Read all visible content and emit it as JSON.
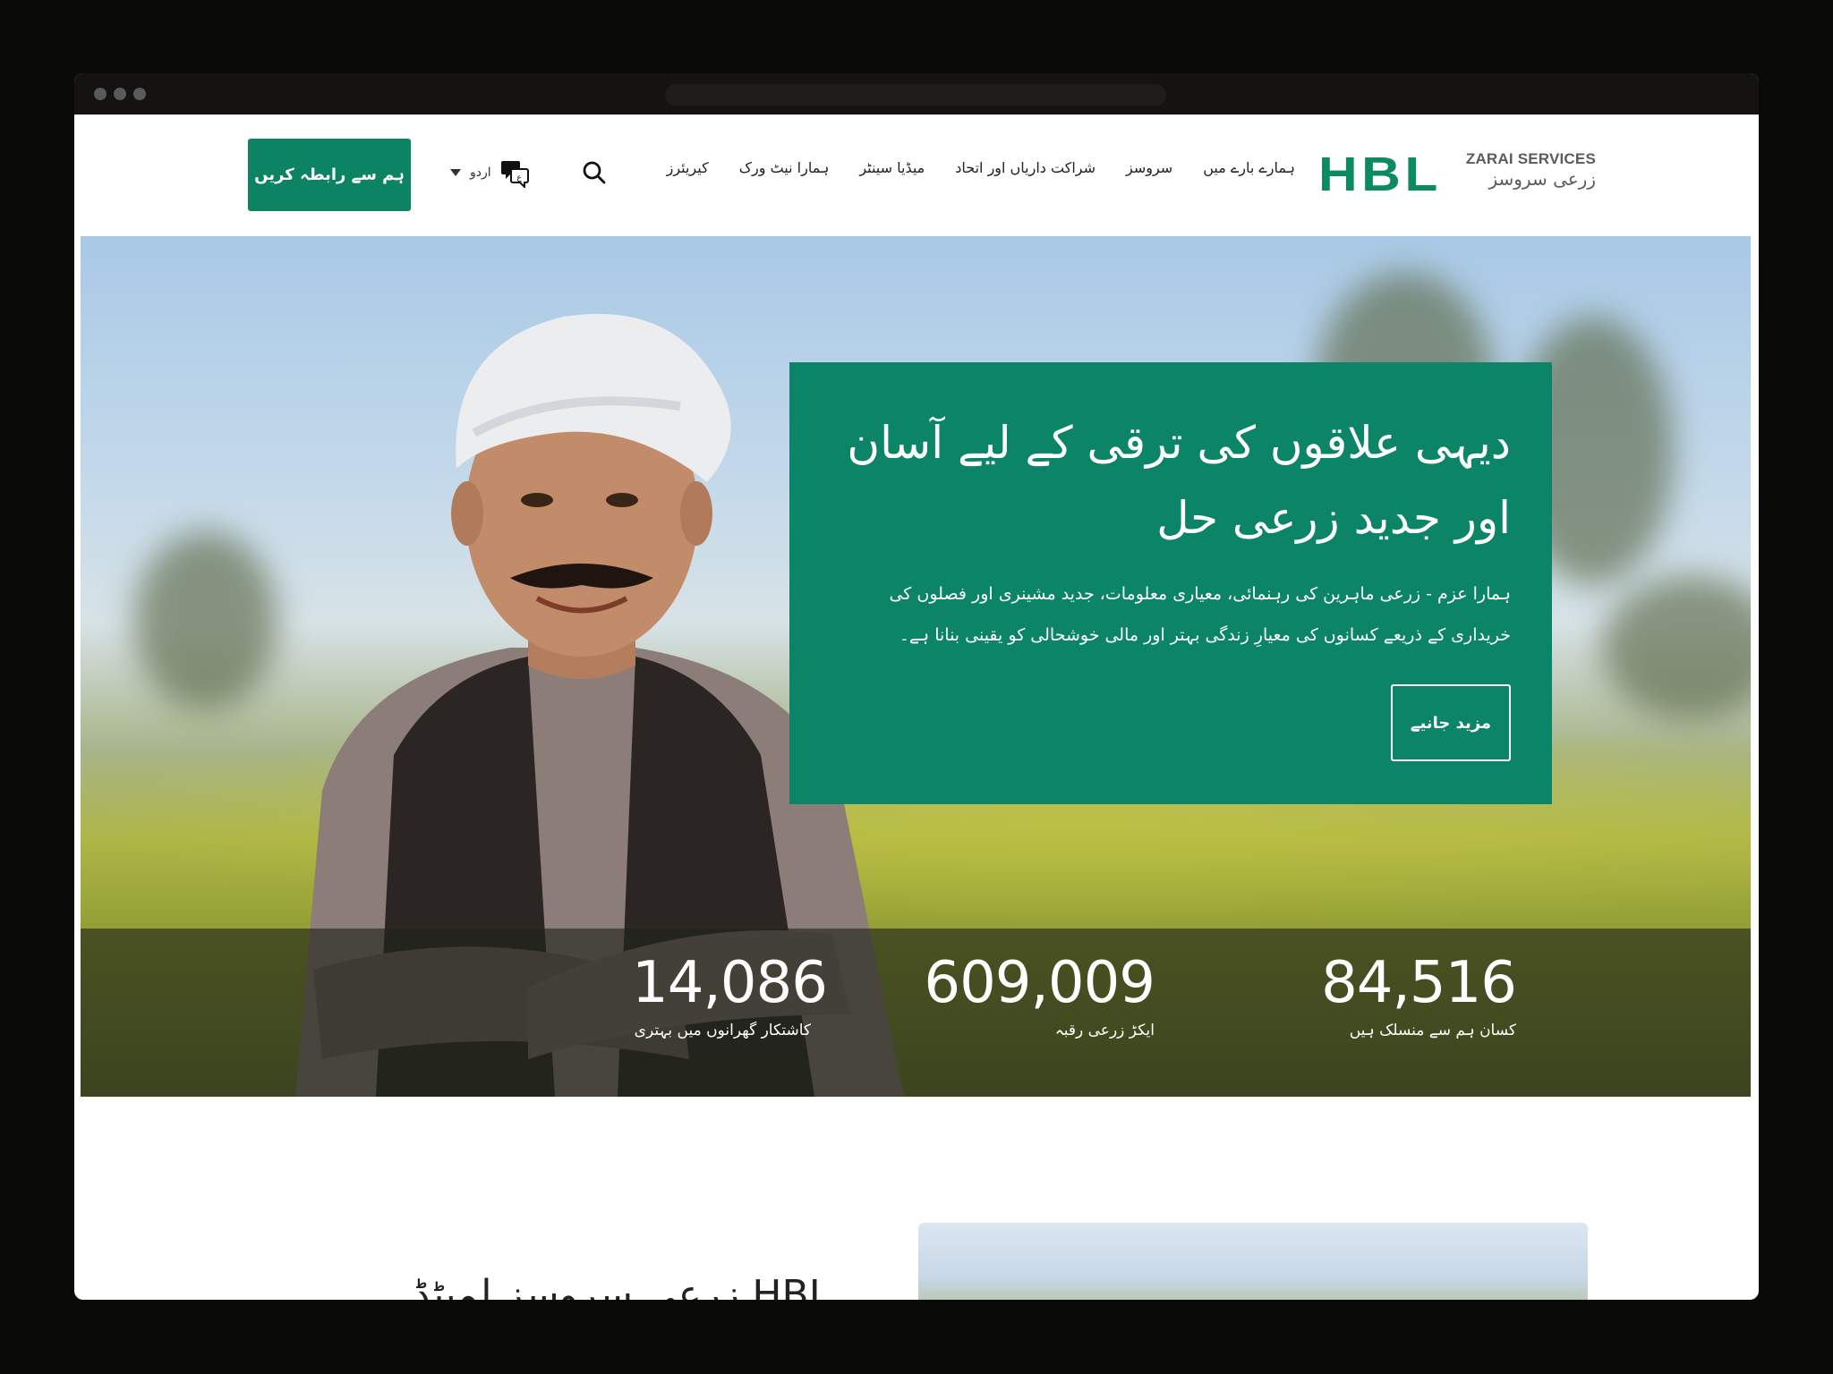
{
  "brand": {
    "name": "HBL",
    "subtitle_en": "ZARAI SERVICES",
    "subtitle_ur": "زرعی سروسز",
    "accent_color": "#0c8464"
  },
  "nav": {
    "items": [
      {
        "label": "ہمارے بارے میں"
      },
      {
        "label": "سروسز"
      },
      {
        "label": "شراکت داریاں اور اتحاد"
      },
      {
        "label": "میڈیا سینٹر"
      },
      {
        "label": "ہمارا نیٹ ورک"
      },
      {
        "label": "کیریئرز"
      }
    ],
    "search_icon": "search-icon",
    "language_label": "اردو",
    "language_icon": "translate-icon",
    "contact_label": "ہم سے رابطہ کریں"
  },
  "hero": {
    "title_line1": "دیہی علاقوں کی ترقی کے لیے آسان",
    "title_line2": "اور جدید زرعی حل",
    "desc_line1": "ہمارا عزم - زرعی ماہرین کی رہنمائی، معیاری معلومات، جدید مشینری اور فصلوں کی",
    "desc_line2": "خریداری کے ذریعے کسانوں کی معیارِ زندگی بہتر اور مالی خوشحالی کو یقینی بنانا ہے۔",
    "button_label": "مزید جانیے"
  },
  "stats": [
    {
      "value": "84,516",
      "label": "کسان ہم سے منسلک ہیں"
    },
    {
      "value": "609,009",
      "label": "ایکڑ زرعی رقبہ"
    },
    {
      "value": "14,086",
      "label": "کاشتکار گھرانوں میں بہتری"
    }
  ],
  "section2": {
    "title": "HBL زرعی سروسز لمیٹڈ"
  }
}
